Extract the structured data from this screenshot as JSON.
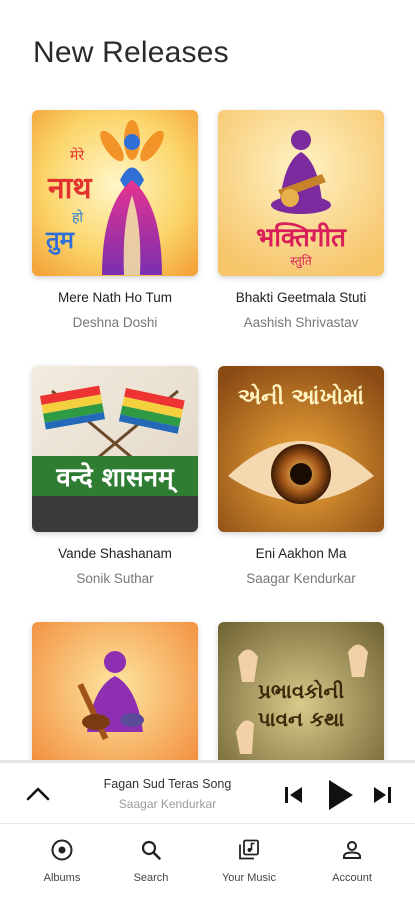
{
  "page": {
    "title": "New Releases"
  },
  "albums": [
    {
      "title": "Mere Nath Ho Tum",
      "artist": "Deshna Doshi",
      "cover_text": "मेरे नाथ हो तुम"
    },
    {
      "title": "Bhakti Geetmala Stuti",
      "artist": "Aashish Shrivastav",
      "cover_text": "भक्तिगीत",
      "cover_subtext": "स्तुति"
    },
    {
      "title": "Vande Shashanam",
      "artist": "Sonik Suthar",
      "cover_text": "वन्दे शासनम्"
    },
    {
      "title": "Eni Aakhon Ma",
      "artist": "Saagar Kendurkar",
      "cover_text": "એની આંખોમાં"
    },
    {
      "title": "",
      "artist": ""
    },
    {
      "title": "",
      "artist": "",
      "cover_text": "પ્રભાવકોની",
      "cover_subtext": "પાવન કથા"
    }
  ],
  "player": {
    "title": "Fagan Sud Teras Song",
    "artist": "Saagar Kendurkar"
  },
  "nav": [
    {
      "label": "Albums",
      "icon": "album-icon"
    },
    {
      "label": "Search",
      "icon": "search-icon"
    },
    {
      "label": "Your Music",
      "icon": "library-music-icon"
    },
    {
      "label": "Account",
      "icon": "account-icon"
    }
  ],
  "colors": {
    "accent": "#f39a1e",
    "purple": "#7b2b9e",
    "text": "#222222",
    "muted": "#777777"
  }
}
